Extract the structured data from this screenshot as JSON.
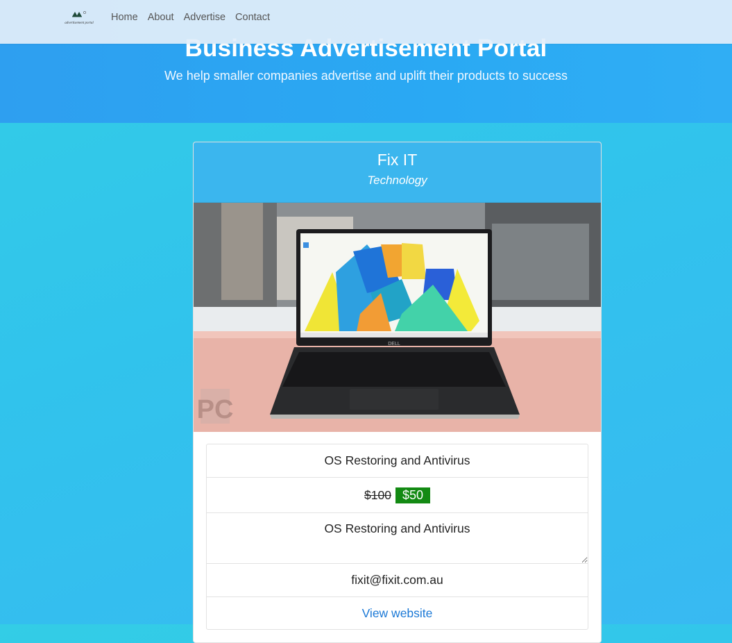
{
  "nav": {
    "logo_text": "advertisement portal",
    "links": [
      "Home",
      "About",
      "Advertise",
      "Contact"
    ]
  },
  "hero": {
    "title": "Business Advertisement Portal",
    "subtitle": "We help smaller companies advertise and uplift their products to success"
  },
  "card": {
    "company": "Fix IT",
    "category": "Technology",
    "image_watermark": "PC",
    "laptop_brand": "DELL",
    "service_title": "OS Restoring and Antivirus",
    "old_price": "$100",
    "new_price": "$50",
    "description": "OS Restoring and Antivirus",
    "email": "fixit@fixit.com.au",
    "website_link": "View website"
  },
  "colors": {
    "accent_green": "#138a13",
    "link_blue": "#1a78d6",
    "card_header": "#3bb6ee"
  }
}
